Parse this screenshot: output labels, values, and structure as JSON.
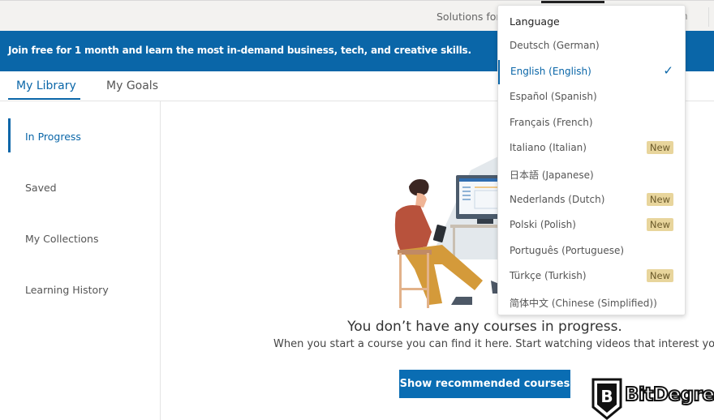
{
  "topbar": {
    "solutions_label": "Solutions for:",
    "tail_text": "n"
  },
  "banner": {
    "text": "Join free for 1 month and learn the most in-demand business, tech, and creative skills."
  },
  "tabs": [
    {
      "label": "My Library",
      "active": true
    },
    {
      "label": "My Goals",
      "active": false
    }
  ],
  "sidebar": {
    "items": [
      {
        "label": "In Progress",
        "active": true
      },
      {
        "label": "Saved",
        "active": false
      },
      {
        "label": "My Collections",
        "active": false
      },
      {
        "label": "Learning History",
        "active": false
      }
    ]
  },
  "main": {
    "empty_title": "You don’t have any courses in progress.",
    "empty_subtitle": "When you start a course you can find it here. Start watching videos that interest you.",
    "cta_label": "Show recommended courses"
  },
  "language_menu": {
    "header": "Language",
    "items": [
      {
        "label": "Deutsch (German)",
        "selected": false,
        "badge": ""
      },
      {
        "label": "English (English)",
        "selected": true,
        "badge": ""
      },
      {
        "label": "Español (Spanish)",
        "selected": false,
        "badge": ""
      },
      {
        "label": "Français (French)",
        "selected": false,
        "badge": ""
      },
      {
        "label": "Italiano (Italian)",
        "selected": false,
        "badge": "New"
      },
      {
        "label": "日本語 (Japanese)",
        "selected": false,
        "badge": ""
      },
      {
        "label": "Nederlands (Dutch)",
        "selected": false,
        "badge": "New"
      },
      {
        "label": "Polski (Polish)",
        "selected": false,
        "badge": "New"
      },
      {
        "label": "Português (Portuguese)",
        "selected": false,
        "badge": ""
      },
      {
        "label": "Türkçe (Turkish)",
        "selected": false,
        "badge": "New"
      },
      {
        "label": "简体中文 (Chinese (Simplified))",
        "selected": false,
        "badge": ""
      }
    ],
    "check_glyph": "✓"
  },
  "watermark": {
    "brand": "BitDegree",
    "mark_letter": "B"
  },
  "colors": {
    "brand_blue": "#0a66a8",
    "badge_bg": "#e8d59c"
  }
}
